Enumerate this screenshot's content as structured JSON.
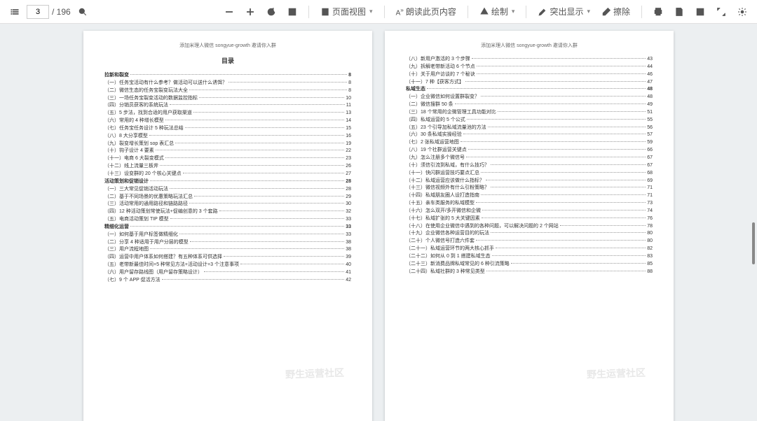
{
  "toolbar": {
    "current_page": "3",
    "total_pages": "/ 196",
    "page_view": "页面视图",
    "read_aloud": "朗读此页内容",
    "draw": "绘制",
    "highlight": "突出显示",
    "erase": "擦除"
  },
  "doc": {
    "header": "添加米理人微信 songyue-growth 邀请你入群",
    "toc_title": "目录",
    "watermark": "野生运营社区",
    "left": [
      {
        "t": "拉新和裂变",
        "p": "8",
        "b": 1
      },
      {
        "t": "（一）任务宝活动有什么参考？做活动可以送什么诱饵？",
        "p": "8"
      },
      {
        "t": "（二）微信生态的任务宝裂变玩法大全",
        "p": "8"
      },
      {
        "t": "（三）一场任务宝裂变活动的数据监控指标",
        "p": "10"
      },
      {
        "t": "（四）分销员获客的系统玩法",
        "p": "11"
      },
      {
        "t": "（五）5 步法，找到合适的用户获取渠道",
        "p": "13"
      },
      {
        "t": "（六）常用的 4 种增长模型",
        "p": "14"
      },
      {
        "t": "（七）任务宝任务设计 5 种玩法总结",
        "p": "15"
      },
      {
        "t": "（八）8 大分享模型",
        "p": "16"
      },
      {
        "t": "（九）裂变增长策划 sop 表汇总",
        "p": "19"
      },
      {
        "t": "（十）钩子设计 4 要素",
        "p": "22"
      },
      {
        "t": "（十一）电商 6 大裂变模式",
        "p": "23"
      },
      {
        "t": "（十二）线上流量三板斧",
        "p": "26"
      },
      {
        "t": "（十三）设变群的 20 个核心关键点",
        "p": "27"
      },
      {
        "t": "活动策划和促销设计",
        "p": "28",
        "b": 1
      },
      {
        "t": "（一）三大常见促销活动玩法",
        "p": "28"
      },
      {
        "t": "（二）基于不同场景的优惠策略玩法汇总",
        "p": "29"
      },
      {
        "t": "（三）活动常用的通用路径和链路路径",
        "p": "30"
      },
      {
        "t": "（四）12 种活动策划常使玩法+促编创意的 3 个套路",
        "p": "32"
      },
      {
        "t": "（五）电商活动策划 TIP 模型",
        "p": "33"
      },
      {
        "t": "精细化运营",
        "p": "33",
        "b": 1
      },
      {
        "t": "（一）如何基于用户标签做精细化",
        "p": "33"
      },
      {
        "t": "（二）分享 4 种适用于用户分层的模型",
        "p": "38"
      },
      {
        "t": "（三）用户流程地图",
        "p": "38"
      },
      {
        "t": "（四）运营中用户体系如何搭建？有五种体系可供选择",
        "p": "39"
      },
      {
        "t": "（五）老带新最佳时间+5 种常见方法+活动设计+3 个注意事项",
        "p": "40"
      },
      {
        "t": "（六）用户留存路线图（用户留存策略设计）",
        "p": "41"
      },
      {
        "t": "（七）9 个 APP 促活方法",
        "p": "42"
      }
    ],
    "right": [
      {
        "t": "（八）新用户激活的 3 个步骤",
        "p": "43"
      },
      {
        "t": "（九）拆解老带新活动 6 个节点",
        "p": "44"
      },
      {
        "t": "（十）关于用户访谈的 7 个秘诀",
        "p": "46"
      },
      {
        "t": "（十一）7 种【获客方式】",
        "p": "47"
      },
      {
        "t": "私域生态",
        "p": "48",
        "b": 1
      },
      {
        "t": "（一）企业微信如何设置群裂变？",
        "p": "48"
      },
      {
        "t": "（二）微信搜群 50 条",
        "p": "49"
      },
      {
        "t": "（三）18 个常用的企微管理工具功能对比",
        "p": "51"
      },
      {
        "t": "（四）私域运营的 5 个公式",
        "p": "55"
      },
      {
        "t": "（五）23 个引导加私域流量池的方法",
        "p": "56"
      },
      {
        "t": "（六）30 条私域实操经验",
        "p": "57"
      },
      {
        "t": "（七）2 张私域运营地图",
        "p": "59"
      },
      {
        "t": "（八）19 个社群运营关键点",
        "p": "66"
      },
      {
        "t": "（九）怎么注册多个微信号",
        "p": "67"
      },
      {
        "t": "（十）须信引流到私域，有什么技巧？",
        "p": "67"
      },
      {
        "t": "（十一）快闪群运营技巧要点汇总",
        "p": "68"
      },
      {
        "t": "（十二）私域运营应该做什么指标？",
        "p": "69"
      },
      {
        "t": "（十三）微信视频外有什么引粉策略？",
        "p": "71"
      },
      {
        "t": "（十四）私域朋友圈人设打造指南",
        "p": "71"
      },
      {
        "t": "（十五）亲车类服务的私域模型",
        "p": "73"
      },
      {
        "t": "（十六）怎么双开/多开微信和企微",
        "p": "74"
      },
      {
        "t": "（十七）私域扩张的 5 大关键因素",
        "p": "76"
      },
      {
        "t": "（十八）在使用企业微信中遇到的各种问题，可以解决问题的 2 个网站",
        "p": "78"
      },
      {
        "t": "（十九）企业微信各种运营目的的玩法",
        "p": "80"
      },
      {
        "t": "（二十）个人微信号打造六件套",
        "p": "80"
      },
      {
        "t": "（二十一）私域运营环节的两大核心抓手",
        "p": "82"
      },
      {
        "t": "（二十二）如何从 0 到 1 搭建私域生态",
        "p": "83"
      },
      {
        "t": "（二十三）新消费品牌私域常见的 6 种引流策略",
        "p": "85"
      },
      {
        "t": "（二十四）私域社群的 3 种常见类型",
        "p": "88"
      }
    ]
  }
}
